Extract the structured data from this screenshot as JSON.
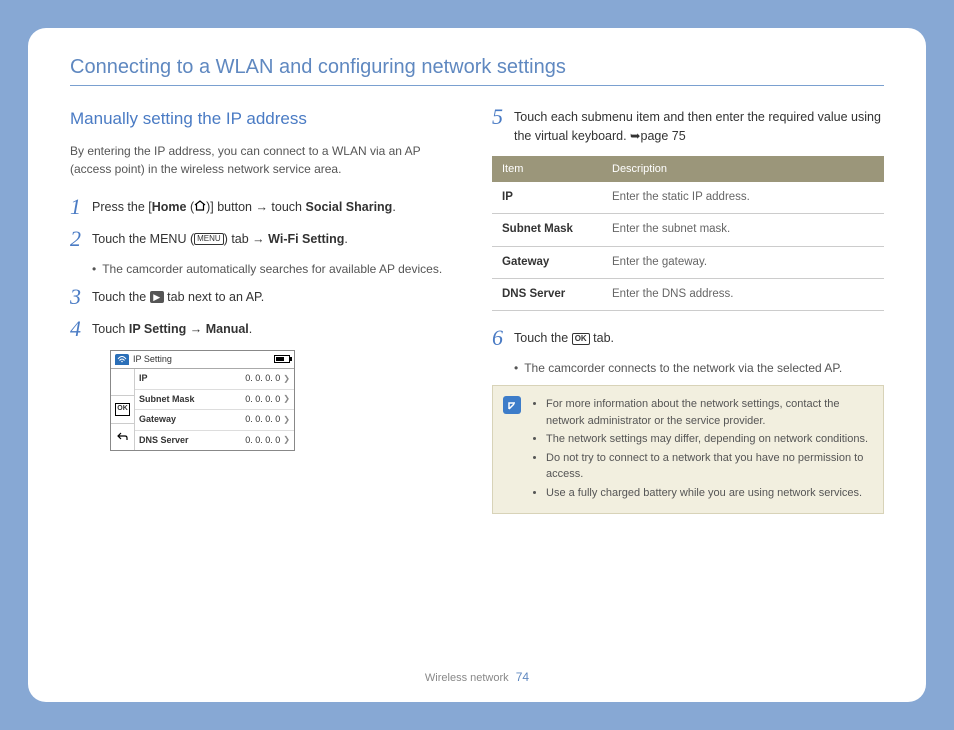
{
  "page_title": "Connecting to a WLAN and configuring network settings",
  "section_title": "Manually setting the IP address",
  "intro": "By entering the IP address, you can connect to a WLAN via an AP (access point) in the wireless network service area.",
  "steps": {
    "s1_a": "Press the [",
    "s1_b": "Home",
    "s1_c": " (",
    "s1_d": ")] button → touch ",
    "s1_e": "Social Sharing",
    "s1_f": ".",
    "s2_a": "Touch the MENU (",
    "s2_b": ") tab → ",
    "s2_c": "Wi-Fi Setting",
    "s2_d": ".",
    "s2_bullet": "The camcorder automatically searches for available AP devices.",
    "s3_a": "Touch the ",
    "s3_b": " tab next to an AP.",
    "s4_a": "Touch ",
    "s4_b": "IP Setting",
    "s4_c": " → ",
    "s4_d": "Manual",
    "s4_e": ".",
    "s5": "Touch each submenu item and then enter the required value using the virtual keyboard. ➥page 75",
    "s6_a": "Touch the ",
    "s6_b": " tab.",
    "s6_bullet": "The camcorder connects to the network via the selected AP."
  },
  "device": {
    "title": "IP Setting",
    "ok": "OK",
    "rows": [
      {
        "label": "IP",
        "value": "0. 0. 0. 0"
      },
      {
        "label": "Subnet Mask",
        "value": "0. 0. 0. 0"
      },
      {
        "label": "Gateway",
        "value": "0. 0. 0. 0"
      },
      {
        "label": "DNS Server",
        "value": "0. 0. 0. 0"
      }
    ]
  },
  "table": {
    "h1": "Item",
    "h2": "Description",
    "rows": [
      {
        "item": "IP",
        "desc": "Enter the static IP address."
      },
      {
        "item": "Subnet Mask",
        "desc": "Enter the subnet mask."
      },
      {
        "item": "Gateway",
        "desc": "Enter the gateway."
      },
      {
        "item": "DNS Server",
        "desc": "Enter the DNS address."
      }
    ]
  },
  "notes": [
    "For more information about the network settings, contact the network administrator or the service provider.",
    "The network settings may differ, depending on network conditions.",
    "Do not try to connect to a network that you have no permission to access.",
    "Use a fully charged battery while you are using network services."
  ],
  "footer_section": "Wireless network",
  "footer_page": "74",
  "labels": {
    "menu": "MENU",
    "ok": "OK"
  }
}
